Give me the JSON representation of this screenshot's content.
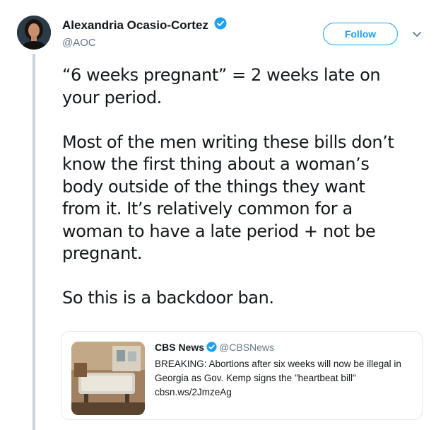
{
  "tweet": {
    "author_name": "Alexandria Ocasio-Cortez",
    "author_handle": "@AOC",
    "follow_label": "Follow",
    "text": "“6 weeks pregnant” = 2 weeks late on\nyour period.\n\nMost of the men writing these bills don’t\nknow the first thing about a woman’s\nbody outside of the things they want\nfrom it. It’s relatively common for a\nwoman to have a late period + not be\npregnant.\n\nSo this is a backdoor ban."
  },
  "quoted_tweet": {
    "author_name": "CBS News",
    "author_handle": "@CBSNews",
    "text": "BREAKING: Abortions after six weeks will now be illegal in Georgia as Gov. Kemp signs the \"heartbeat bill\"",
    "link": "cbsn.ws/2JmzeAg"
  },
  "colors": {
    "accent": "#1da1f2",
    "muted": "#657786",
    "thread_line": "#c9d3dc"
  },
  "icons": [
    "verified-badge-icon",
    "chevron-down-icon"
  ]
}
